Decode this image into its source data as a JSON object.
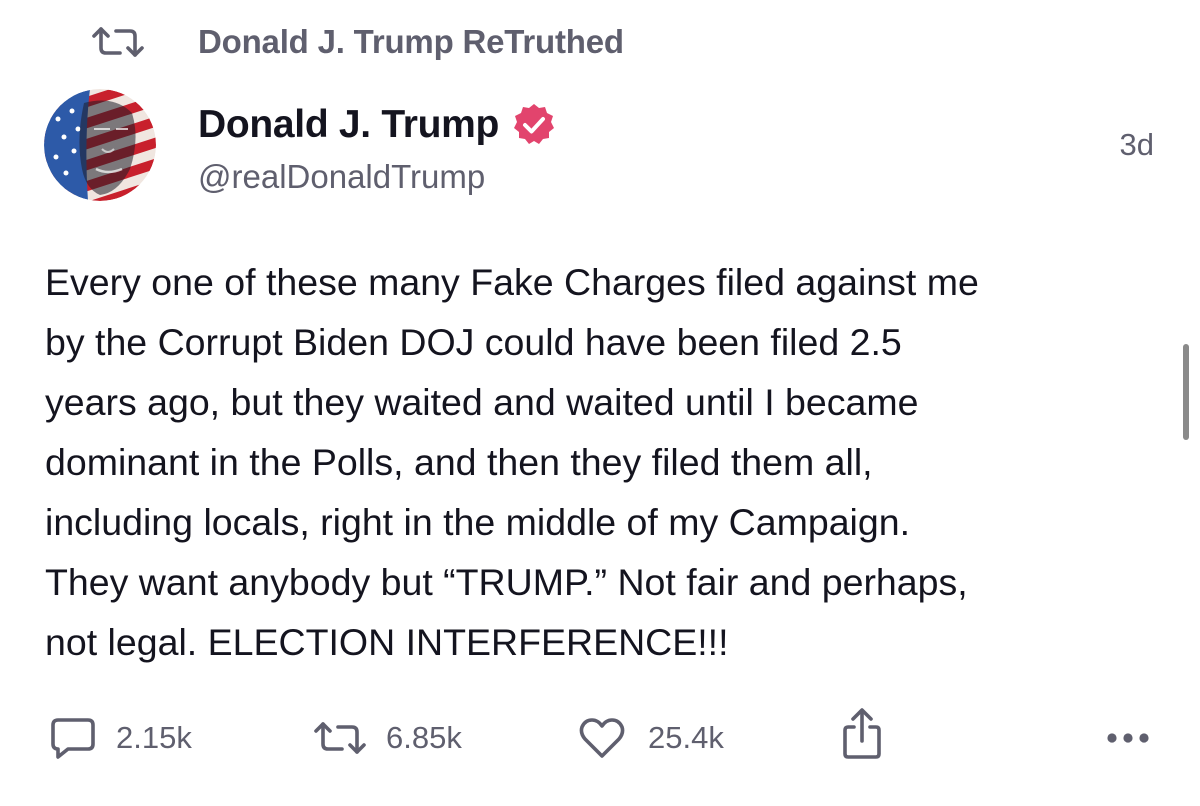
{
  "retruth": {
    "icon": "retruth-icon",
    "label": "Donald J. Trump ReTruthed"
  },
  "author": {
    "avatar": "avatar-image",
    "name": "Donald J. Trump",
    "verified_icon": "verified-badge-icon",
    "handle": "@realDonaldTrump",
    "time_ago": "3d"
  },
  "post": {
    "lines": [
      "Every one of these many Fake Charges filed against me",
      "by the Corrupt Biden DOJ could have been filed 2.5",
      "years ago, but they waited and waited until I became",
      "dominant in the Polls, and then they filed them all,",
      "including locals, right in the middle of my Campaign.",
      "They want anybody but “TRUMP.” Not fair and perhaps,",
      "not legal. ELECTION INTERFERENCE!!!"
    ]
  },
  "actions": {
    "replies": {
      "icon": "comment-icon",
      "count": "2.15k"
    },
    "retruths": {
      "icon": "retruth-icon",
      "count": "6.85k"
    },
    "likes": {
      "icon": "heart-icon",
      "count": "25.4k"
    },
    "share": {
      "icon": "share-icon"
    },
    "more": {
      "icon": "more-icon"
    }
  },
  "colors": {
    "text_primary": "#14141f",
    "text_secondary": "#5f5f6e",
    "verified_badge": "#e2446d"
  }
}
